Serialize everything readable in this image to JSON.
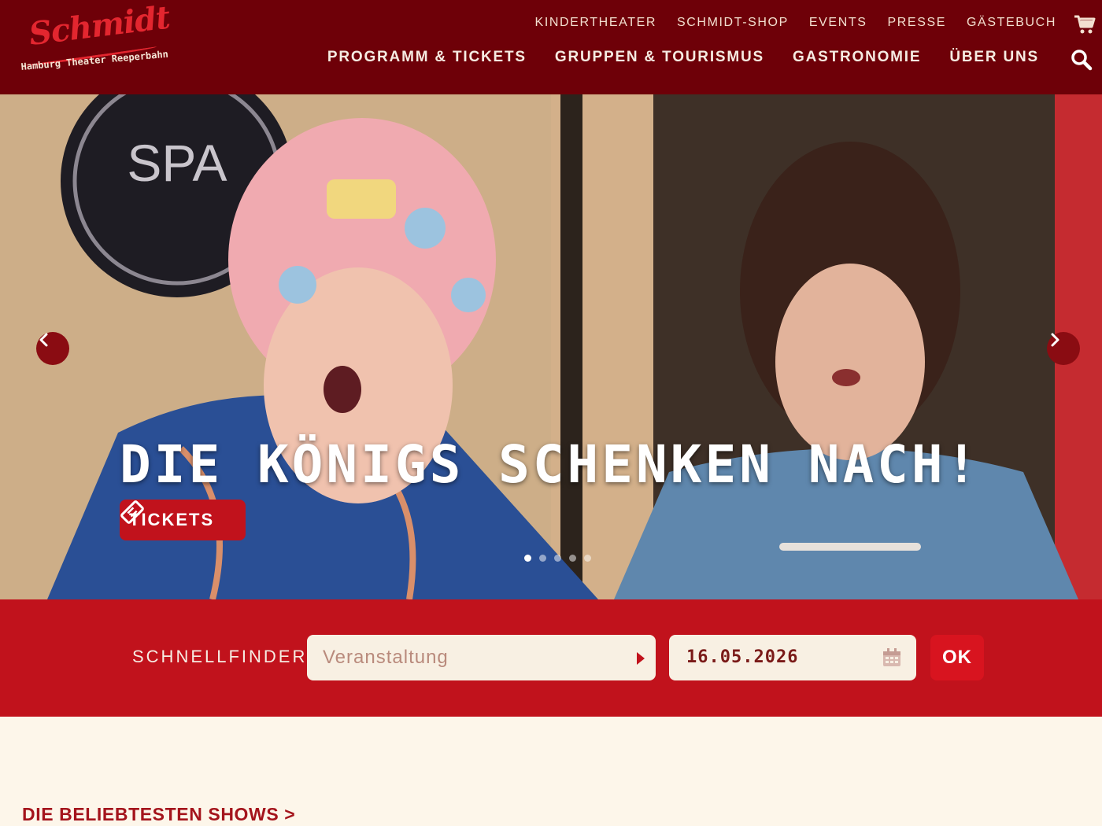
{
  "header": {
    "logo": {
      "name": "Schmidt",
      "sub": "Hamburg Theater Reeperbahn"
    },
    "topnav": [
      "KINDERTHEATER",
      "SCHMIDT-SHOP",
      "EVENTS",
      "PRESSE",
      "GÄSTEBUCH"
    ],
    "mainnav": [
      "PROGRAMM & TICKETS",
      "GRUPPEN & TOURISMUS",
      "GASTRONOMIE",
      "ÜBER UNS"
    ],
    "icons": {
      "cart": "cart-icon",
      "search": "search-icon"
    }
  },
  "hero": {
    "title": "DIE KÖNIGS SCHENKEN NACH!",
    "tickets_label": "TICKETS",
    "slides_total": 5,
    "active_slide": 1
  },
  "finder": {
    "label": "SCHNELLFINDER:",
    "event_placeholder": "Veranstaltung",
    "date_value": "16.05.2026",
    "ok_label": "OK"
  },
  "section": {
    "popular_title": "DIE BELIEBTESTEN SHOWS >"
  },
  "colors": {
    "header": "#6e0008",
    "accent": "#c1121c",
    "background": "#fdf6ea"
  }
}
